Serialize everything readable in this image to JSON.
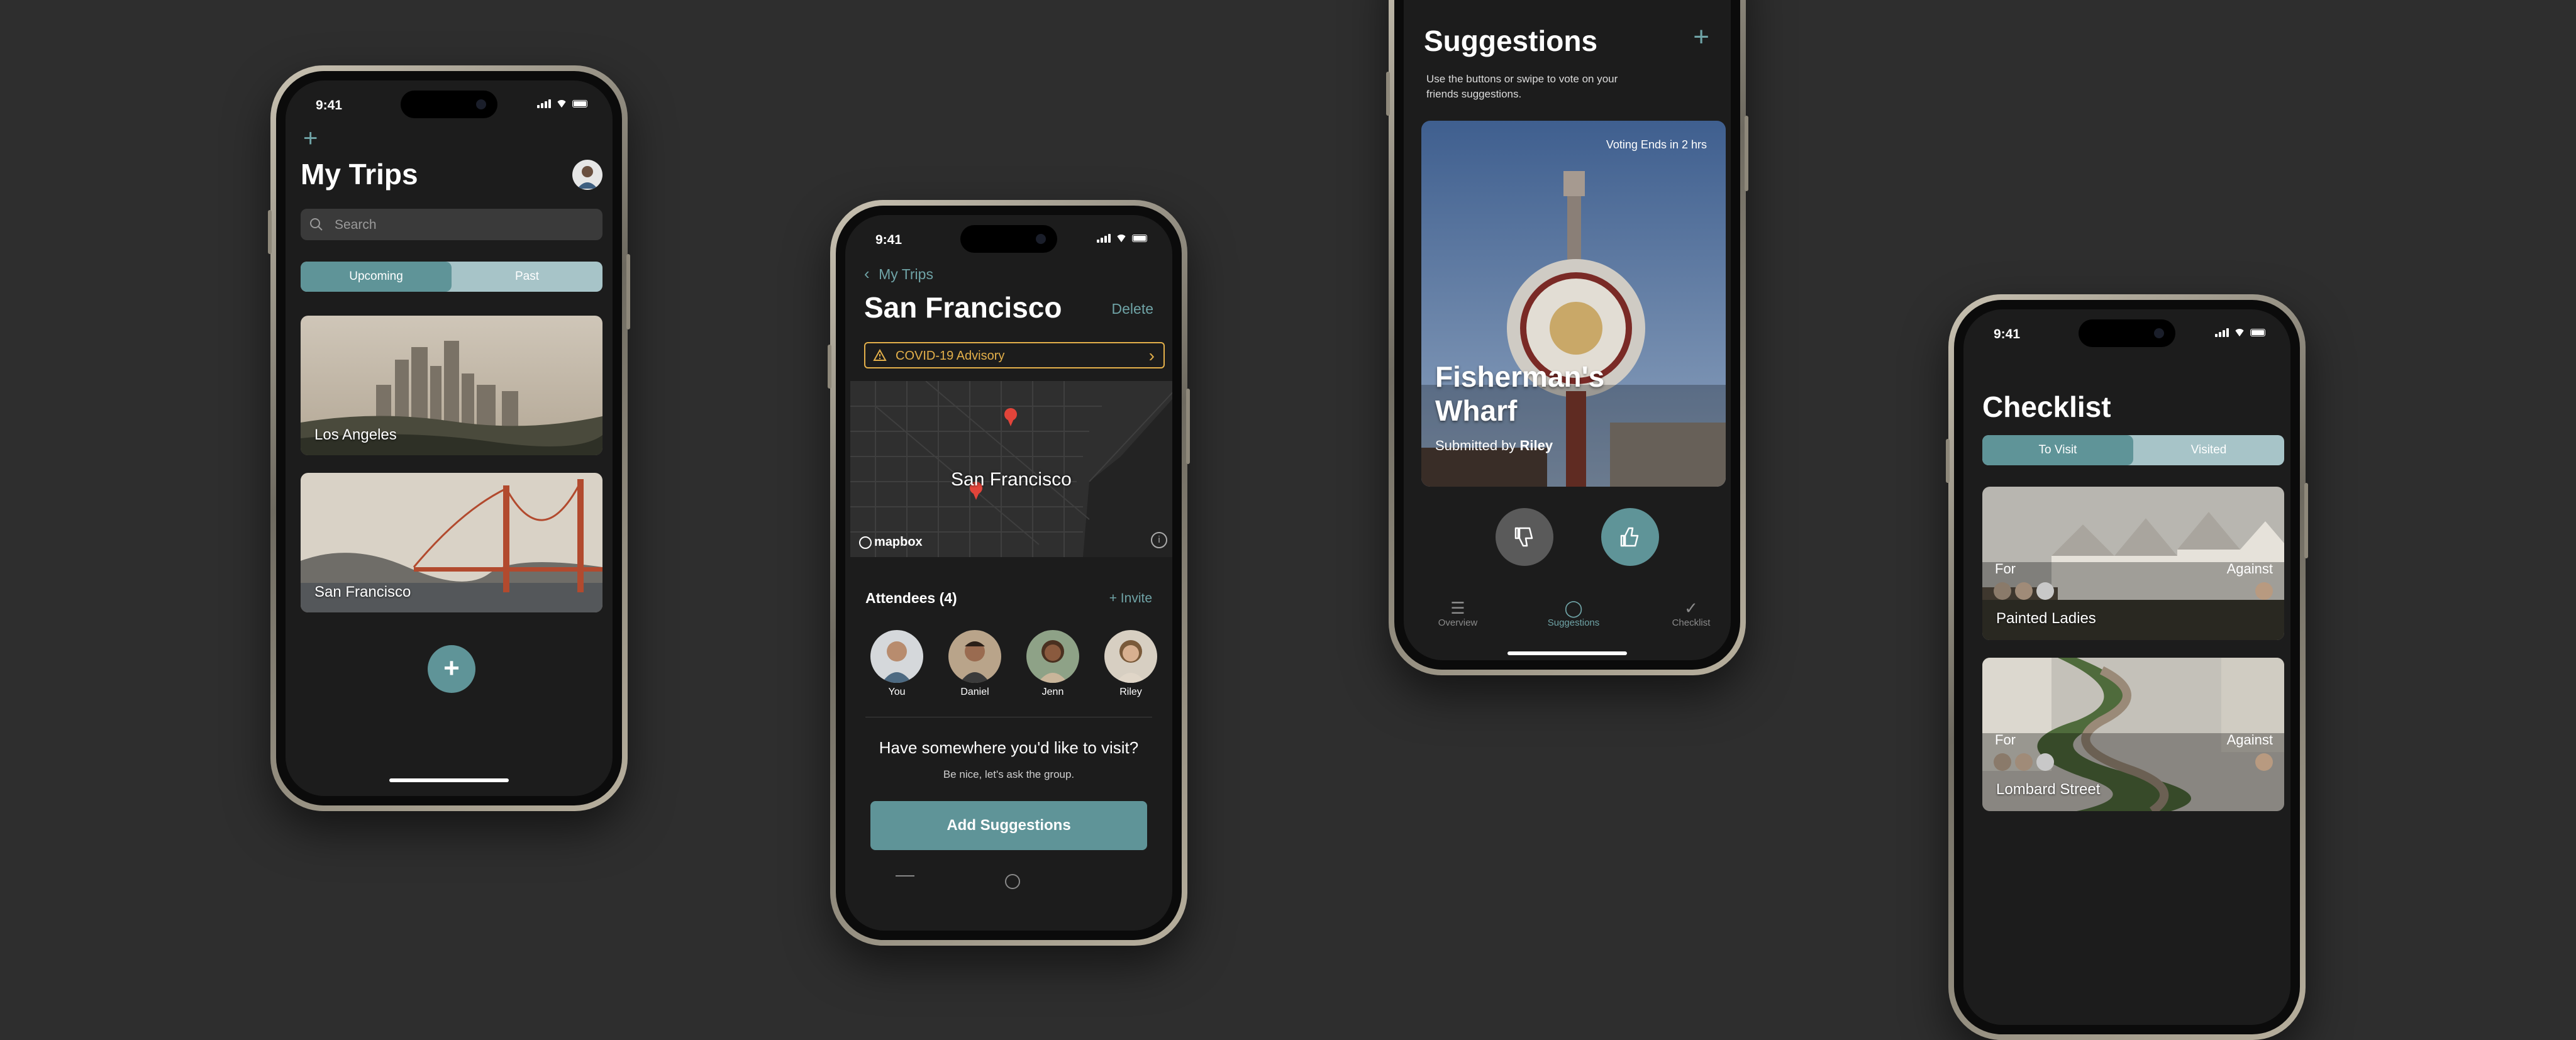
{
  "status_time": "9:41",
  "colors": {
    "background": "#2e2e2e",
    "accent": "#6fa3a6",
    "advisory": "#e4b04a",
    "screen": "#1c1c1c"
  },
  "my_trips": {
    "title": "My Trips",
    "add_icon": "plus-icon",
    "search_placeholder": "Search",
    "tabs": [
      "Upcoming",
      "Past"
    ],
    "active_tab": "Upcoming",
    "trips": [
      "Los Angeles",
      "San Francisco"
    ],
    "fab_icon": "plus-icon"
  },
  "trip_detail": {
    "back_label": "My Trips",
    "title": "San Francisco",
    "delete_label": "Delete",
    "advisory": "COVID-19 Advisory",
    "map_city": "San Francisco",
    "map_logo": "mapbox",
    "attendees_label": "Attendees (4)",
    "invite_label": "+ Invite",
    "attendees": [
      "You",
      "Daniel",
      "Jenn",
      "Riley"
    ],
    "prompt_title": "Have somewhere you'd like to visit?",
    "prompt_sub": "Be nice, let's ask the group.",
    "add_button": "Add Suggestions"
  },
  "suggestions": {
    "title": "Suggestions",
    "desc": "Use the buttons or swipe to vote on your friends suggestions.",
    "voting": "Voting Ends in 2 hrs",
    "place": "Fisherman's Wharf",
    "submitted_prefix": "Submitted by",
    "submitted_by": "Riley",
    "tabs": [
      "Overview",
      "Suggestions",
      "Checklist"
    ],
    "active_tab": "Suggestions"
  },
  "checklist": {
    "title": "Checklist",
    "tabs": [
      "To Visit",
      "Visited"
    ],
    "active_tab": "To Visit",
    "for_label": "For",
    "against_label": "Against",
    "items": [
      "Painted Ladies",
      "Lombard Street"
    ]
  }
}
